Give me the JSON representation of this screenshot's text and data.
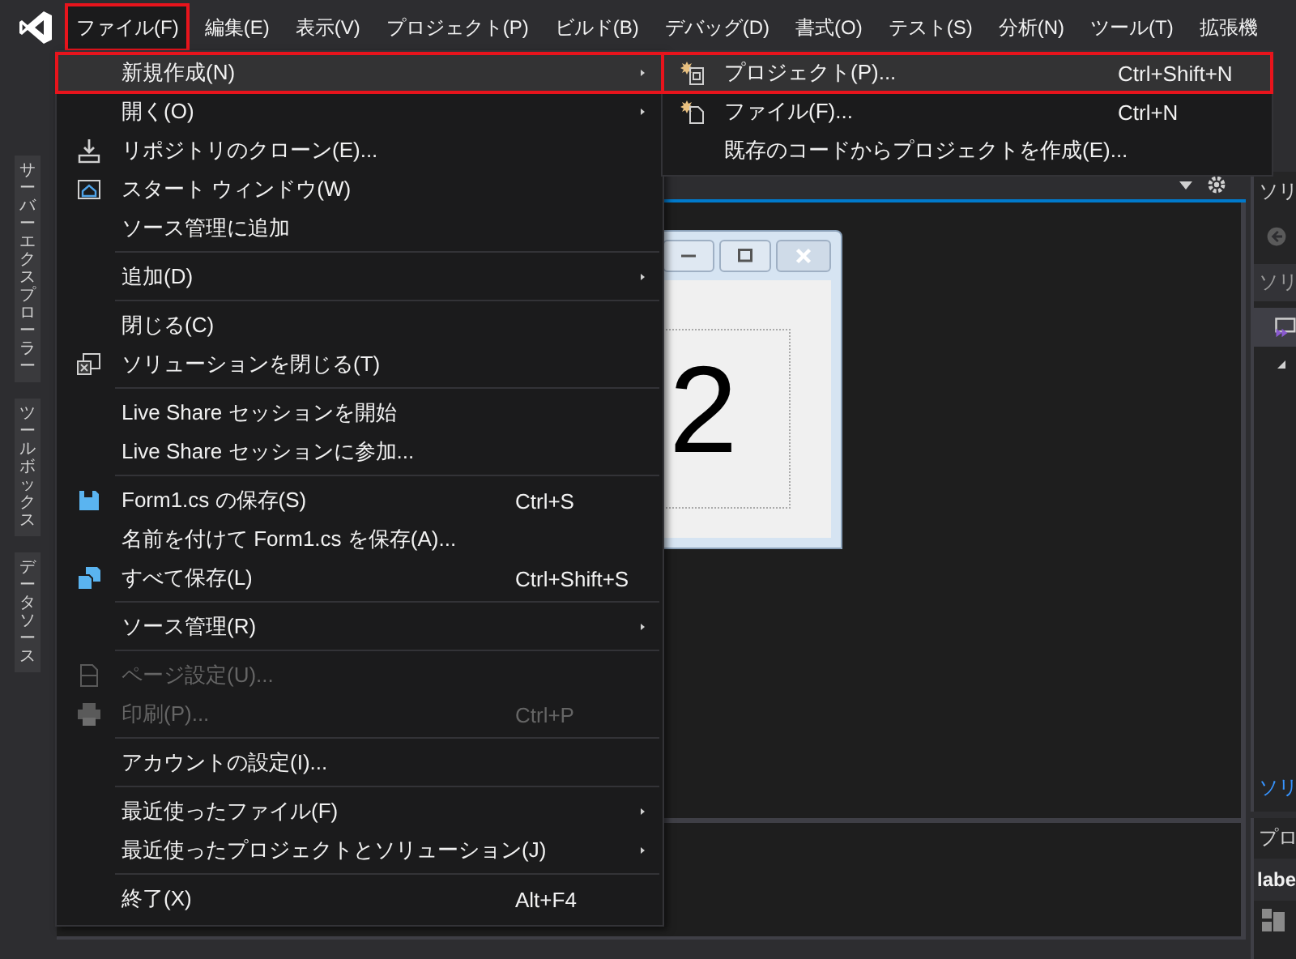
{
  "menubar": [
    {
      "label": "ファイル(F)",
      "open": true,
      "highlighted": true
    },
    {
      "label": "編集(E)",
      "open": false,
      "highlighted": false
    },
    {
      "label": "表示(V)",
      "open": false,
      "highlighted": false
    },
    {
      "label": "プロジェクト(P)",
      "open": false,
      "highlighted": false
    },
    {
      "label": "ビルド(B)",
      "open": false,
      "highlighted": false
    },
    {
      "label": "デバッグ(D)",
      "open": false,
      "highlighted": false
    },
    {
      "label": "書式(O)",
      "open": false,
      "highlighted": false
    },
    {
      "label": "テスト(S)",
      "open": false,
      "highlighted": false
    },
    {
      "label": "分析(N)",
      "open": false,
      "highlighted": false
    },
    {
      "label": "ツール(T)",
      "open": false,
      "highlighted": false
    },
    {
      "label": "拡張機",
      "open": false,
      "highlighted": false
    }
  ],
  "file_menu": {
    "items": [
      {
        "kind": "item",
        "label": "新規作成(N)",
        "submenu": true,
        "selected": true,
        "highlighted": true,
        "disabled": false
      },
      {
        "kind": "item",
        "label": "開く(O)",
        "submenu": true,
        "selected": false,
        "highlighted": false,
        "disabled": false
      },
      {
        "kind": "item",
        "label": "リポジトリのクローン(E)...",
        "submenu": false,
        "selected": false,
        "highlighted": false,
        "disabled": false
      },
      {
        "kind": "item",
        "label": "スタート ウィンドウ(W)",
        "submenu": false,
        "selected": false,
        "highlighted": false,
        "disabled": false
      },
      {
        "kind": "item",
        "label": "ソース管理に追加",
        "submenu": false,
        "selected": false,
        "highlighted": false,
        "disabled": false
      },
      {
        "kind": "separator"
      },
      {
        "kind": "item",
        "label": "追加(D)",
        "submenu": true,
        "selected": false,
        "highlighted": false,
        "disabled": false
      },
      {
        "kind": "separator"
      },
      {
        "kind": "item",
        "label": "閉じる(C)",
        "submenu": false,
        "selected": false,
        "highlighted": false,
        "disabled": false
      },
      {
        "kind": "item",
        "label": "ソリューションを閉じる(T)",
        "submenu": false,
        "selected": false,
        "highlighted": false,
        "disabled": false
      },
      {
        "kind": "separator"
      },
      {
        "kind": "item",
        "label": "Live Share セッションを開始",
        "submenu": false,
        "selected": false,
        "highlighted": false,
        "disabled": false
      },
      {
        "kind": "item",
        "label": "Live Share セッションに参加...",
        "submenu": false,
        "selected": false,
        "highlighted": false,
        "disabled": false
      },
      {
        "kind": "separator"
      },
      {
        "kind": "item",
        "label": "Form1.cs の保存(S)",
        "shortcut": "Ctrl+S",
        "submenu": false,
        "selected": false,
        "highlighted": false,
        "disabled": false
      },
      {
        "kind": "item",
        "label": "名前を付けて Form1.cs を保存(A)...",
        "submenu": false,
        "selected": false,
        "highlighted": false,
        "disabled": false
      },
      {
        "kind": "item",
        "label": "すべて保存(L)",
        "shortcut": "Ctrl+Shift+S",
        "submenu": false,
        "selected": false,
        "highlighted": false,
        "disabled": false
      },
      {
        "kind": "separator"
      },
      {
        "kind": "item",
        "label": "ソース管理(R)",
        "submenu": true,
        "selected": false,
        "highlighted": false,
        "disabled": false
      },
      {
        "kind": "separator"
      },
      {
        "kind": "item",
        "label": "ページ設定(U)...",
        "submenu": false,
        "selected": false,
        "highlighted": false,
        "disabled": true
      },
      {
        "kind": "item",
        "label": "印刷(P)...",
        "shortcut": "Ctrl+P",
        "submenu": false,
        "selected": false,
        "highlighted": false,
        "disabled": true
      },
      {
        "kind": "separator"
      },
      {
        "kind": "item",
        "label": "アカウントの設定(I)...",
        "submenu": false,
        "selected": false,
        "highlighted": false,
        "disabled": false
      },
      {
        "kind": "separator"
      },
      {
        "kind": "item",
        "label": "最近使ったファイル(F)",
        "submenu": true,
        "selected": false,
        "highlighted": false,
        "disabled": false
      },
      {
        "kind": "item",
        "label": "最近使ったプロジェクトとソリューション(J)",
        "submenu": true,
        "selected": false,
        "highlighted": false,
        "disabled": false
      },
      {
        "kind": "separator"
      },
      {
        "kind": "item",
        "label": "終了(X)",
        "shortcut": "Alt+F4",
        "submenu": false,
        "selected": false,
        "highlighted": false,
        "disabled": false
      }
    ]
  },
  "new_submenu": {
    "items": [
      {
        "label": "プロジェクト(P)...",
        "shortcut": "Ctrl+Shift+N",
        "selected": true,
        "highlighted": true
      },
      {
        "label": "ファイル(F)...",
        "shortcut": "Ctrl+N",
        "selected": false,
        "highlighted": false
      },
      {
        "label": "既存のコードからプロジェクトを作成(E)...",
        "selected": false,
        "highlighted": false
      }
    ]
  },
  "side_tabs": [
    "サーバーエクスプローラー",
    "ツールボックス",
    "データソース"
  ],
  "designer": {
    "form": {
      "label_text": "2"
    }
  },
  "solution_panel": {
    "title": "ソリ",
    "search": "ソリ",
    "footer": "ソリ"
  },
  "properties_panel": {
    "title": "プロ",
    "object": "labe"
  }
}
